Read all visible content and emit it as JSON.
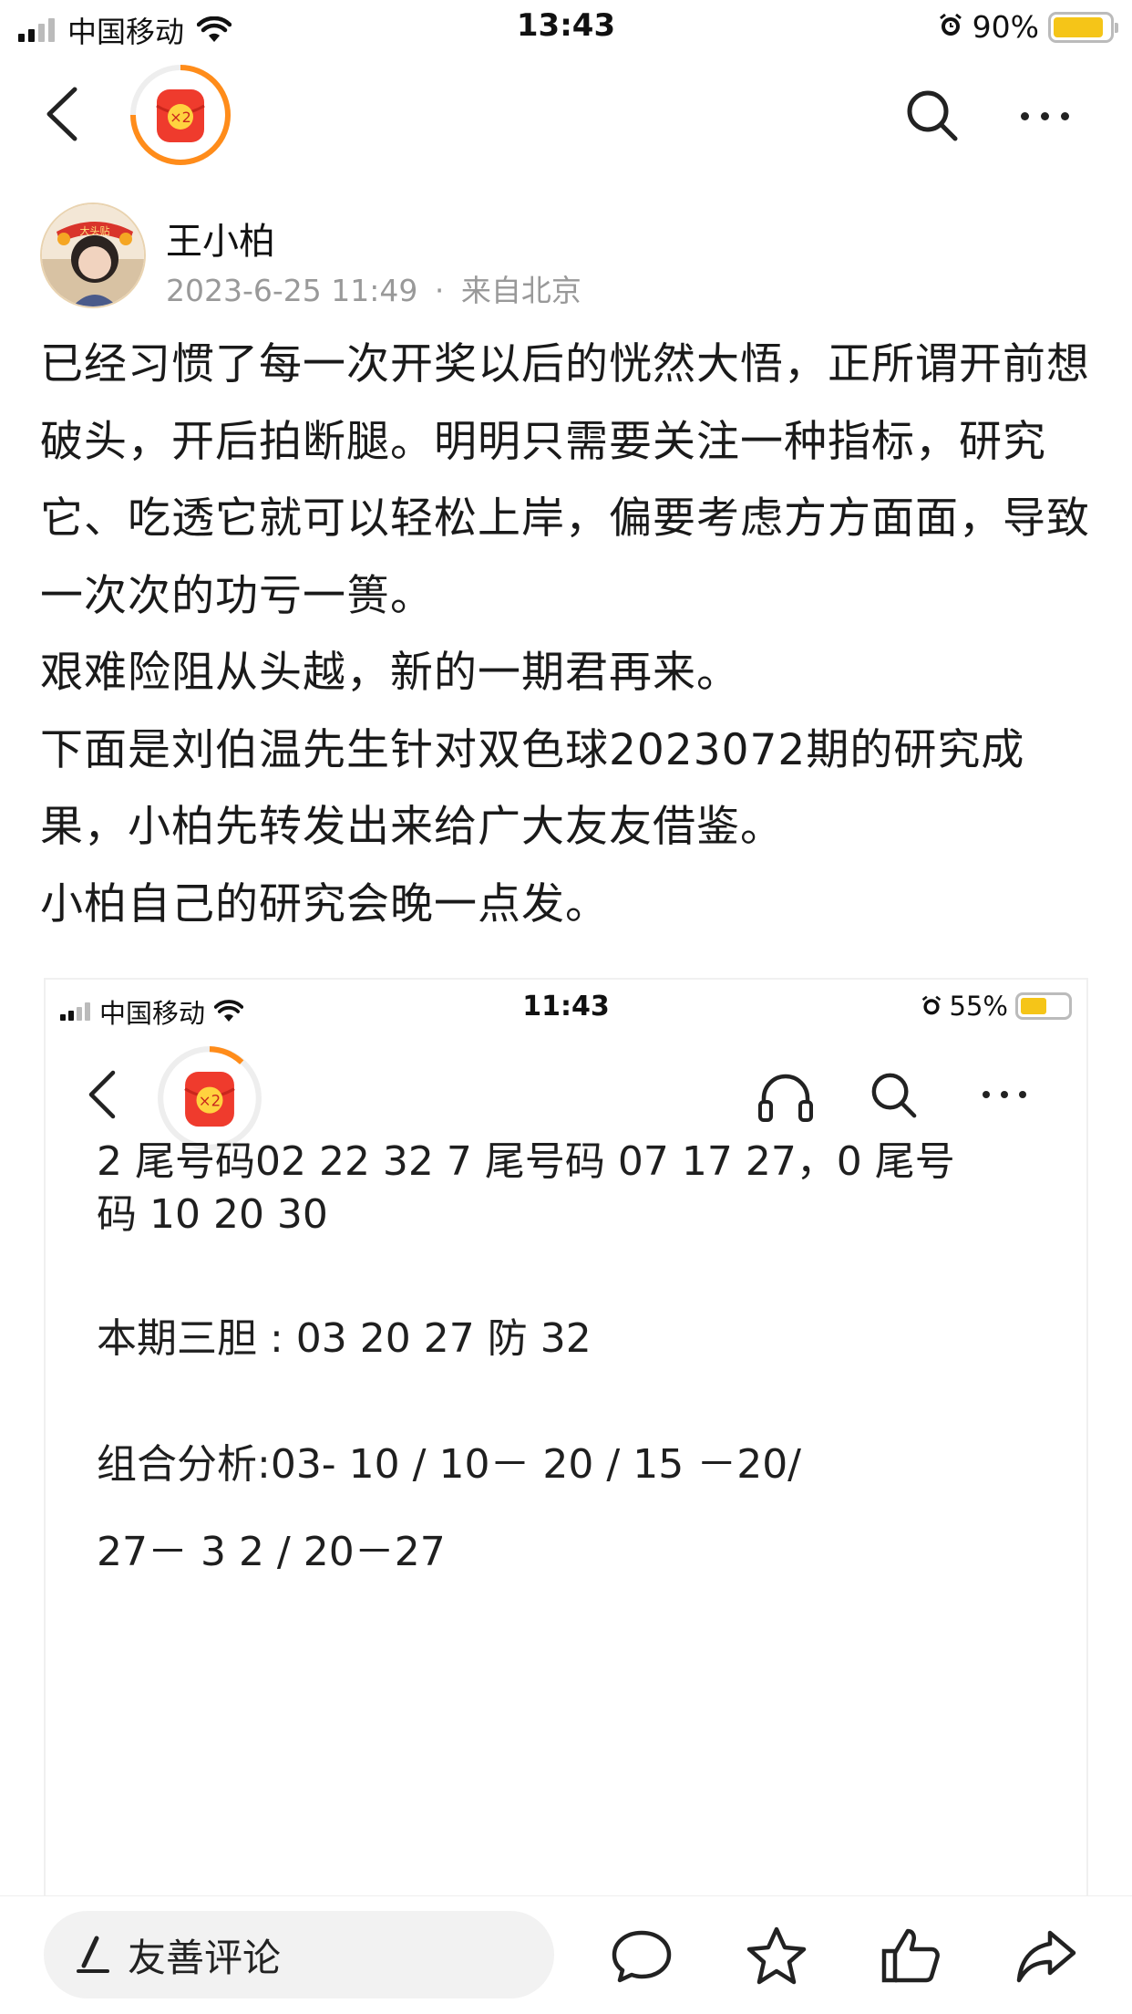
{
  "status_bar": {
    "carrier": "中国移动",
    "time": "13:43",
    "battery_percent": "90%",
    "battery_level": 0.9,
    "battery_color": "#f5c518"
  },
  "nav": {
    "back_icon": "chevron-left-icon",
    "redpacket_badge": "×2",
    "search_icon": "search-icon",
    "more_icon": "more-horizontal-icon"
  },
  "author": {
    "name": "王小柏",
    "date": "2023-6-25 11:49",
    "separator": "·",
    "location": "来自北京",
    "avatar_badge": "大头贴"
  },
  "post": {
    "paragraphs": [
      "已经习惯了每一次开奖以后的恍然大悟，正所谓开前想破头，开后拍断腿。明明只需要关注一种指标，研究它、吃透它就可以轻松上岸，偏要考虑方方面面，导致一次次的功亏一篑。",
      "艰难险阻从头越，新的一期君再来。",
      "下面是刘伯温先生针对双色球2023072期的研究成果，小柏先转发出来给广大友友借鉴。",
      "小柏自己的研究会晚一点发。"
    ]
  },
  "embedded_screenshot": {
    "carrier": "中国移动",
    "time": "11:43",
    "battery_percent": "55%",
    "battery_level": 0.55,
    "redpacket_badge": "×2",
    "icons": [
      "chevron-left-icon",
      "headphones-icon",
      "search-icon",
      "more-horizontal-icon"
    ],
    "lines": [
      "2 尾号码02 22 32 7 尾号码  07 17 27，0 尾号",
      "码 10 20 30",
      "本期三胆 : 03 20 27 防 32",
      "组合分析:03- 10 / 10－ 20 / 15 －20/",
      "27－ 3 2 / 20－27"
    ]
  },
  "bottom_bar": {
    "comment_placeholder": "友善评论",
    "icons": [
      "pen-icon",
      "comment-icon",
      "star-icon",
      "thumbs-up-icon",
      "share-icon"
    ]
  }
}
